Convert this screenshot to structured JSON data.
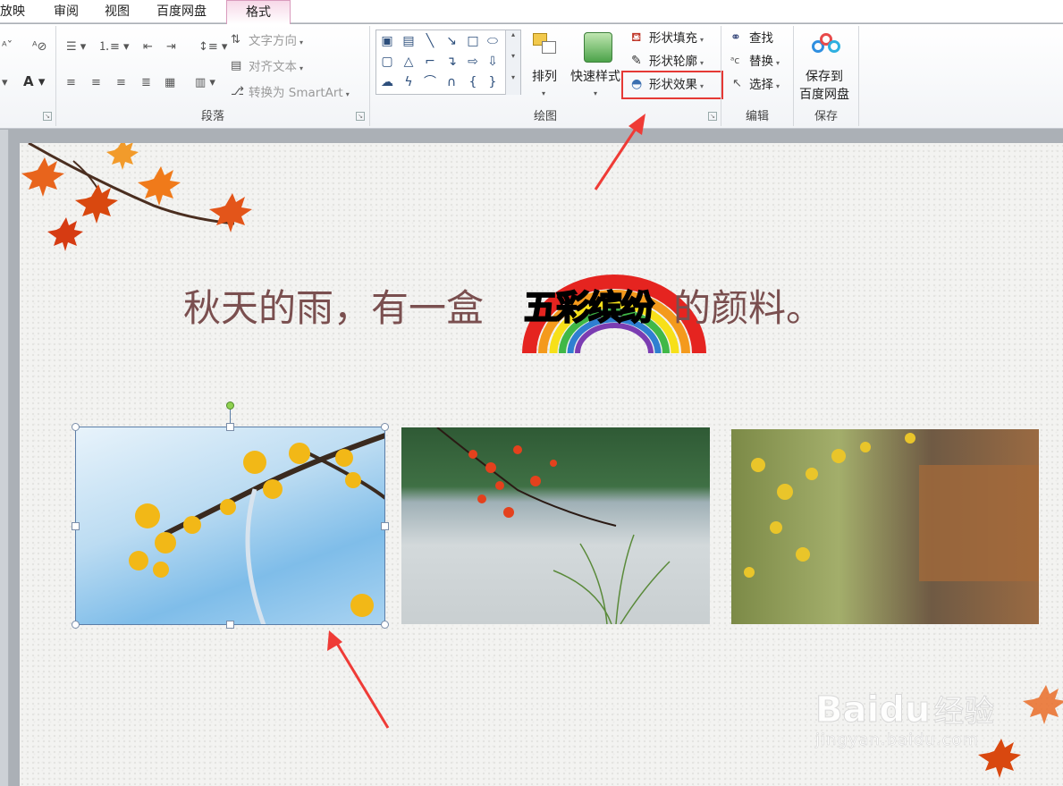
{
  "tabs": [
    "放映",
    "审阅",
    "视图",
    "百度网盘",
    "格式"
  ],
  "paragraph_group": {
    "label": "段落",
    "text_direction": "文字方向",
    "align_text": "对齐文本",
    "convert_smartart": "转换为 SmartArt"
  },
  "drawing_group": {
    "label": "绘图",
    "arrange": "排列",
    "quick_styles": "快速样式",
    "shape_fill": "形状填充",
    "shape_outline": "形状轮廓",
    "shape_effects": "形状效果"
  },
  "editing_group": {
    "label": "编辑",
    "find": "查找",
    "replace": "替换",
    "select": "选择"
  },
  "save_group": {
    "label": "保存",
    "save_line1": "保存到",
    "save_line2": "百度网盘"
  },
  "slide": {
    "title_before": "秋天的雨，有一盒",
    "wordart": "五彩缤纷",
    "title_after": "的颜料。"
  },
  "watermark": {
    "brand": "Bai",
    "brand_du": "du",
    "jingyan": "经验",
    "url": "jingyan.baidu.com"
  },
  "colors": {
    "highlight": "#e53935",
    "title": "#7a4f4f",
    "active_tab": "#f7d8e8"
  }
}
